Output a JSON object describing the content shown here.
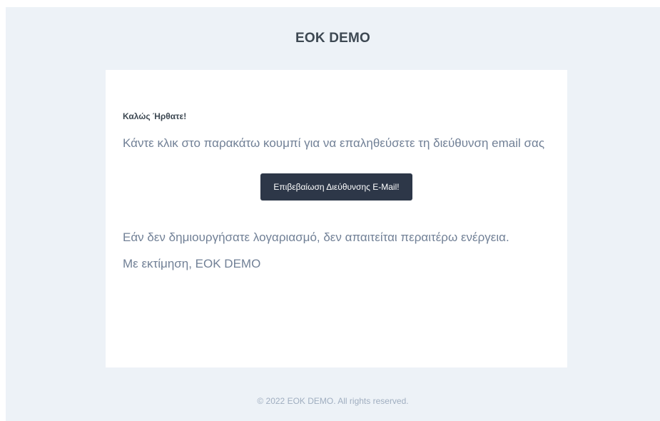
{
  "header": {
    "brand": "EOK DEMO"
  },
  "content": {
    "greeting": "Καλώς Ήρθατε!",
    "intro": "Κάντε κλικ στο παρακάτω κουμπί για να επαληθεύσετε τη διεύθυνση email σας",
    "button_label": "Επιβεβαίωση Διεύθυνσης E-Mail!",
    "outro": "Εάν δεν δημιουργήσατε λογαριασμό, δεν απαιτείται περαιτέρω ενέργεια.",
    "signoff": "Με εκτίμηση, EOK DEMO"
  },
  "footer": {
    "copyright": "© 2022 EOK DEMO. All rights reserved."
  },
  "colors": {
    "background": "#edf2f7",
    "card": "#ffffff",
    "button": "#2d3748",
    "heading": "#3d4852",
    "body_text": "#718096",
    "footer_text": "#a0aec0"
  }
}
